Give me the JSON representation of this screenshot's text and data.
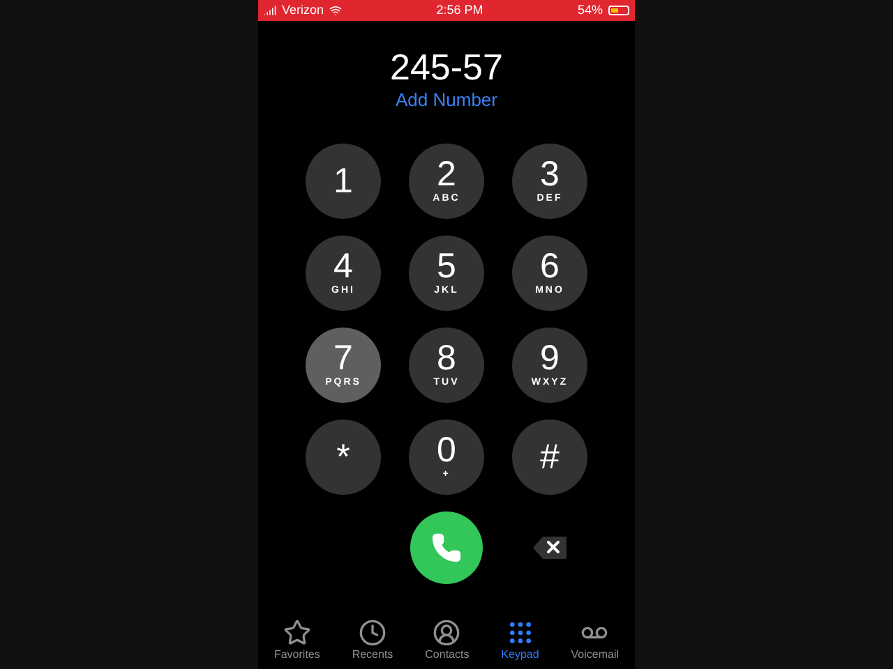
{
  "status_bar": {
    "carrier": "Verizon",
    "time": "2:56 PM",
    "battery": "54%"
  },
  "dialed_number": "245-57",
  "add_number": "Add Number",
  "keys": [
    {
      "digit": "1",
      "pressed": false
    },
    {
      "digit": "2",
      "letters": "ABC",
      "pressed": false
    },
    {
      "digit": "3",
      "letters": "DEF",
      "pressed": false
    },
    {
      "digit": "4",
      "letters": "GHI",
      "pressed": false
    },
    {
      "digit": "5",
      "letters": "JKL",
      "pressed": false
    },
    {
      "digit": "6",
      "letters": "MNO",
      "pressed": false
    },
    {
      "digit": "7",
      "letters": "PQRS",
      "pressed": true
    },
    {
      "digit": "8",
      "letters": "TUV",
      "pressed": false
    },
    {
      "digit": "9",
      "letters": "WXYZ",
      "pressed": false
    },
    {
      "digit": "*",
      "pressed": false
    },
    {
      "digit": "0",
      "letters": "+",
      "pressed": false
    },
    {
      "digit": "#",
      "pressed": false
    }
  ],
  "tabs": [
    {
      "label": "Favorites",
      "kind": "star",
      "selected": false
    },
    {
      "label": "Recents",
      "kind": "clock",
      "selected": false
    },
    {
      "label": "Contacts",
      "kind": "person",
      "selected": false
    },
    {
      "label": "Keypad",
      "kind": "keypad",
      "selected": true
    },
    {
      "label": "Voicemail",
      "kind": "voicemail",
      "selected": false
    }
  ]
}
